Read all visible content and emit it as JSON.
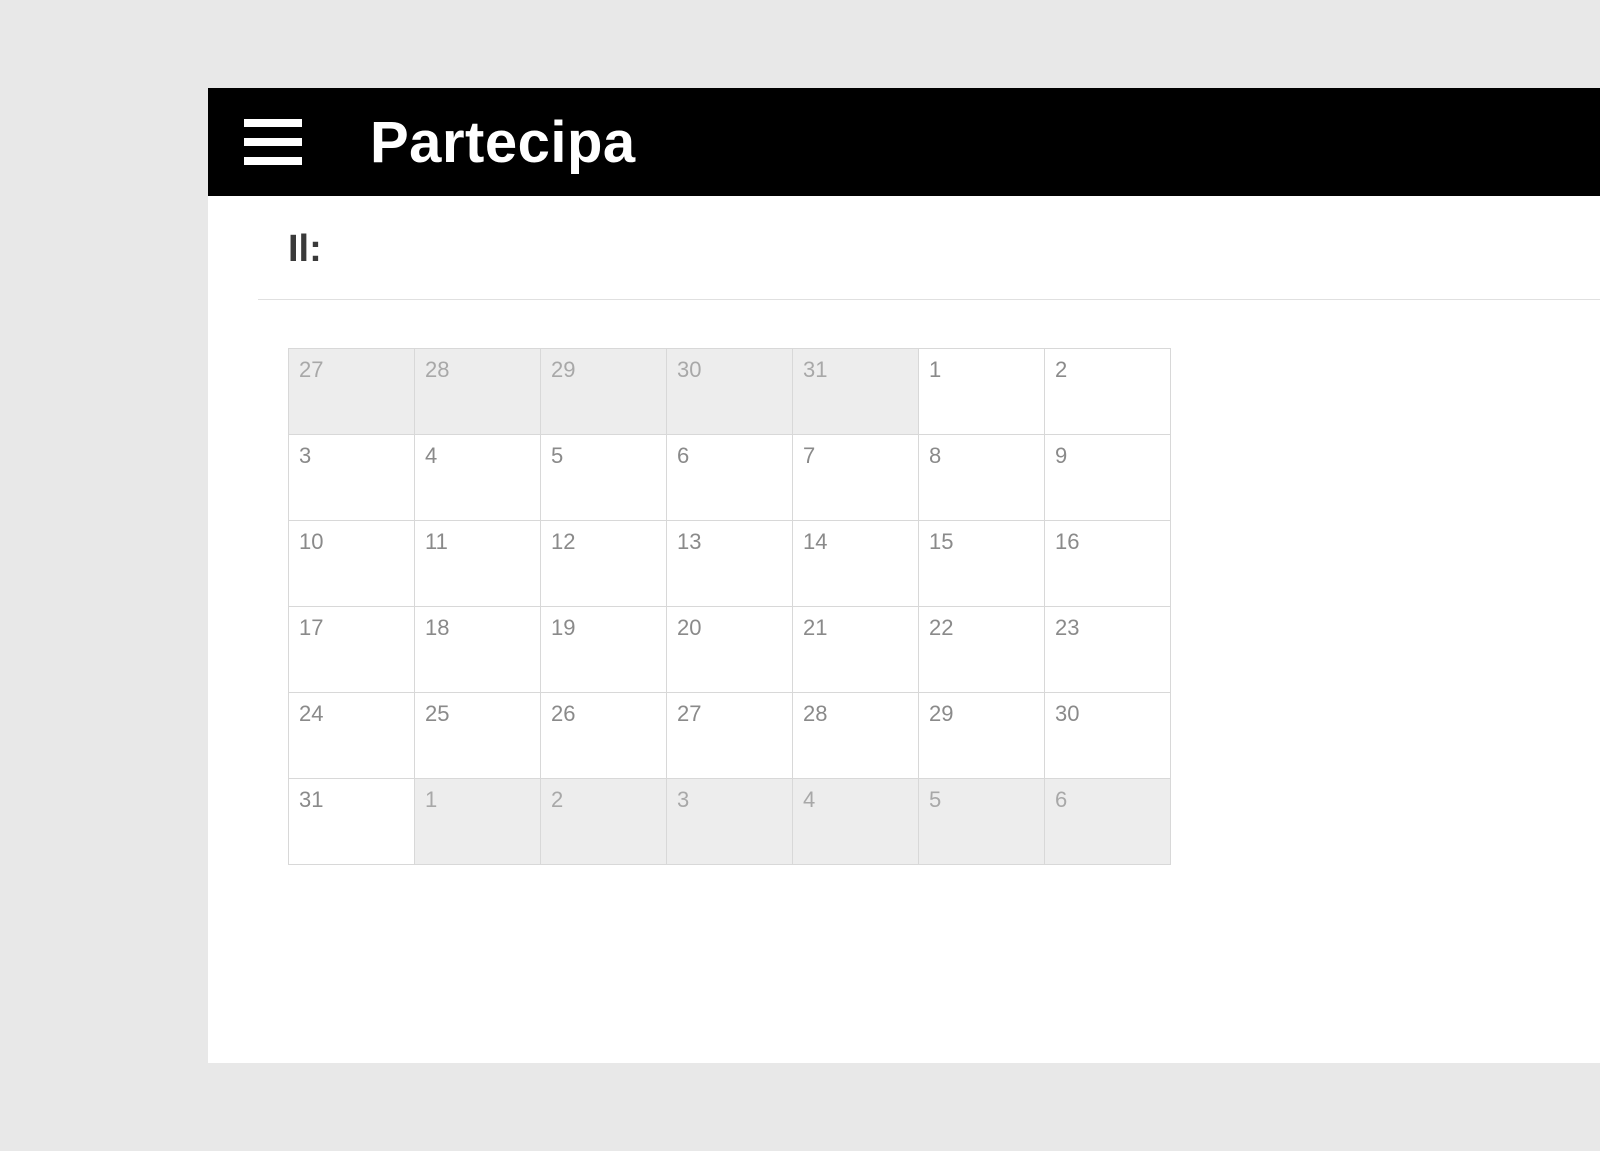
{
  "header": {
    "title": "Partecipa"
  },
  "page": {
    "label": "Il:"
  },
  "calendar": {
    "rows": [
      [
        {
          "day": "27",
          "other": true
        },
        {
          "day": "28",
          "other": true
        },
        {
          "day": "29",
          "other": true
        },
        {
          "day": "30",
          "other": true
        },
        {
          "day": "31",
          "other": true
        },
        {
          "day": "1",
          "other": false
        },
        {
          "day": "2",
          "other": false
        }
      ],
      [
        {
          "day": "3",
          "other": false
        },
        {
          "day": "4",
          "other": false
        },
        {
          "day": "5",
          "other": false
        },
        {
          "day": "6",
          "other": false
        },
        {
          "day": "7",
          "other": false
        },
        {
          "day": "8",
          "other": false
        },
        {
          "day": "9",
          "other": false
        }
      ],
      [
        {
          "day": "10",
          "other": false
        },
        {
          "day": "11",
          "other": false
        },
        {
          "day": "12",
          "other": false
        },
        {
          "day": "13",
          "other": false
        },
        {
          "day": "14",
          "other": false
        },
        {
          "day": "15",
          "other": false
        },
        {
          "day": "16",
          "other": false
        }
      ],
      [
        {
          "day": "17",
          "other": false
        },
        {
          "day": "18",
          "other": false
        },
        {
          "day": "19",
          "other": false
        },
        {
          "day": "20",
          "other": false
        },
        {
          "day": "21",
          "other": false
        },
        {
          "day": "22",
          "other": false
        },
        {
          "day": "23",
          "other": false
        }
      ],
      [
        {
          "day": "24",
          "other": false
        },
        {
          "day": "25",
          "other": false
        },
        {
          "day": "26",
          "other": false
        },
        {
          "day": "27",
          "other": false
        },
        {
          "day": "28",
          "other": false
        },
        {
          "day": "29",
          "other": false
        },
        {
          "day": "30",
          "other": false
        }
      ],
      [
        {
          "day": "31",
          "other": false
        },
        {
          "day": "1",
          "other": true
        },
        {
          "day": "2",
          "other": true
        },
        {
          "day": "3",
          "other": true
        },
        {
          "day": "4",
          "other": true
        },
        {
          "day": "5",
          "other": true
        },
        {
          "day": "6",
          "other": true
        }
      ]
    ]
  }
}
